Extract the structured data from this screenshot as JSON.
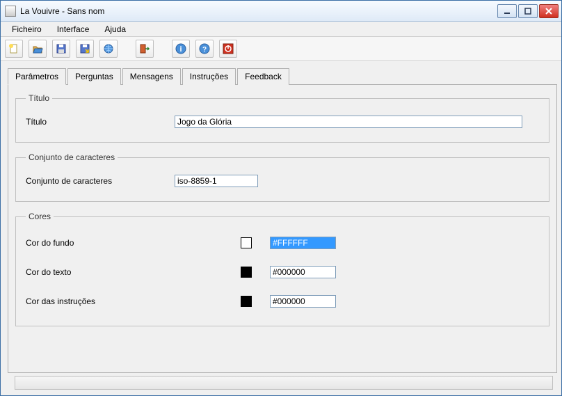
{
  "window": {
    "title": "La Vouivre - Sans nom"
  },
  "menu": {
    "ficheiro": "Ficheiro",
    "interface": "Interface",
    "ajuda": "Ajuda"
  },
  "toolbar_icons": {
    "new": "new-icon",
    "open": "open-icon",
    "save": "save-icon",
    "saveas": "saveas-icon",
    "web": "web-icon",
    "exit": "exit-icon",
    "info": "info-icon",
    "help": "help-icon",
    "power": "power-icon"
  },
  "tabs": {
    "parametros": "Parâmetros",
    "perguntas": "Perguntas",
    "mensagens": "Mensagens",
    "instrucoes": "Instruções",
    "feedback": "Feedback"
  },
  "groupbox": {
    "titulo_legend": "Título",
    "titulo_label": "Título",
    "titulo_value": "Jogo da Glória",
    "charset_legend": "Conjunto de caracteres",
    "charset_label": "Conjunto de caracteres",
    "charset_value": "iso-8859-1",
    "cores_legend": "Cores",
    "cor_fundo_label": "Cor do fundo",
    "cor_fundo_value": "#FFFFFF",
    "cor_fundo_swatch": "#FFFFFF",
    "cor_texto_label": "Cor do texto",
    "cor_texto_value": "#000000",
    "cor_texto_swatch": "#000000",
    "cor_instrucoes_label": "Cor das instruções",
    "cor_instrucoes_value": "#000000",
    "cor_instrucoes_swatch": "#000000"
  }
}
